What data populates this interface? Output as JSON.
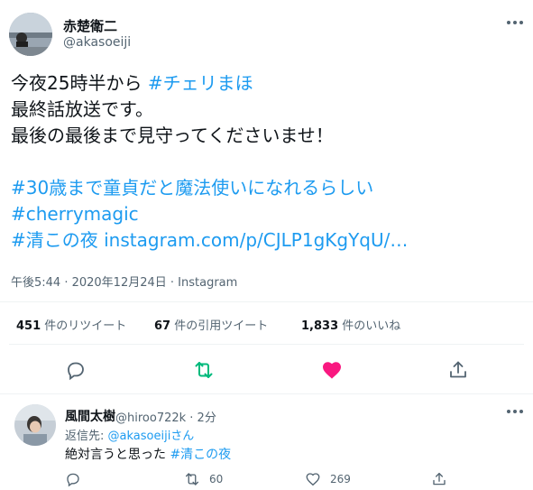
{
  "tweet": {
    "display_name": "赤楚衛二",
    "handle": "@akasoeiji",
    "lines": [
      {
        "pre": "今夜25時半から ",
        "tag": "#チェリまほ"
      },
      {
        "pre": "最終話放送です。"
      },
      {
        "pre": "最後の最後まで見守ってくださいませ！"
      },
      {
        "pre": ""
      },
      {
        "tag": "#30歳まで童貞だと魔法使いになれるらしい"
      },
      {
        "tag": "#cherrymagic"
      },
      {
        "tag": "#清この夜",
        "link": "instagram.com/p/CJLP1gKgYqU/…"
      }
    ],
    "timestamp": "午後5:44 · 2020年12月24日 · Instagram",
    "stats": {
      "retweets_num": "451",
      "retweets_label": "件のリツイート",
      "quotes_num": "67",
      "quotes_label": "件の引用ツイート",
      "likes_num": "1,833",
      "likes_label": "件のいいね"
    },
    "liked_color": "#f91880",
    "retweeted_color": "#00ba7c"
  },
  "reply": {
    "display_name": "風間太樹",
    "handle_time": "@hiroo722k · 2分",
    "reply_to_prefix": "返信先: ",
    "reply_to_handle": "@akasoeijiさん",
    "text_pre": "絶対言うと思った ",
    "text_tag": "#清この夜",
    "retweet_count": "60",
    "like_count": "269"
  },
  "icons": [
    "more-icon",
    "reply-icon",
    "retweet-icon",
    "like-icon",
    "share-icon"
  ]
}
